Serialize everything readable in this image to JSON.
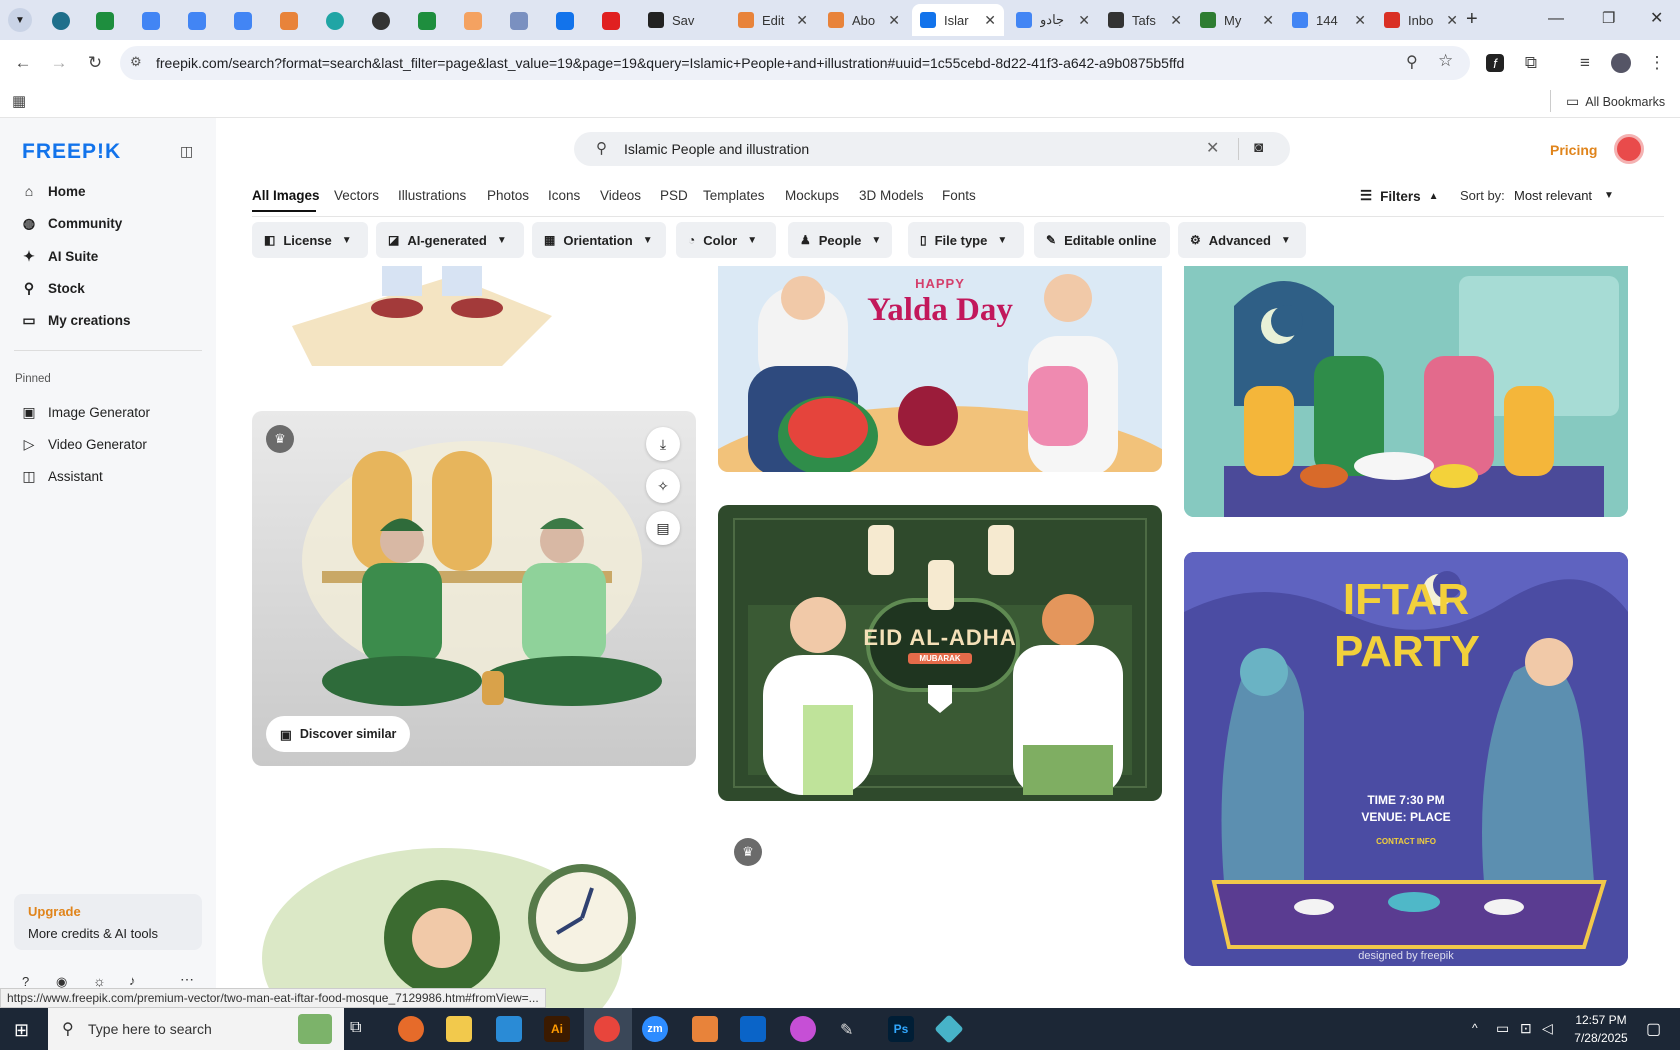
{
  "browser": {
    "tabs": [
      {
        "label": "Sav",
        "color": "#222"
      },
      {
        "label": "Edit",
        "color": "#e8833a"
      },
      {
        "label": "Abo",
        "color": "#e8833a"
      },
      {
        "label": "Islar",
        "color": "#1273eb",
        "active": true
      },
      {
        "label": "جادو",
        "color": "#4285f4"
      },
      {
        "label": "Tafs",
        "color": "#333"
      },
      {
        "label": "My",
        "color": "#2e7d32"
      },
      {
        "label": "144",
        "color": "#4285f4"
      },
      {
        "label": "Inbo",
        "color": "#d93025"
      }
    ],
    "url": "freepik.com/search?format=search&last_filter=page&last_value=19&page=19&query=Islamic+People+and+illustration#uuid=1c55cebd-8d22-41f3-a642-a9b0875b5ffd",
    "bookmarks_label": "All Bookmarks",
    "status_url": "https://www.freepik.com/premium-vector/two-man-eat-iftar-food-mosque_7129986.htm#fromView=..."
  },
  "sidebar": {
    "logo": "FREEP!K",
    "nav": [
      {
        "label": "Home",
        "icon": "home-icon",
        "glyph": "⌂"
      },
      {
        "label": "Community",
        "icon": "globe-icon",
        "glyph": "◍"
      },
      {
        "label": "AI Suite",
        "icon": "sparkle-icon",
        "glyph": "✦"
      },
      {
        "label": "Stock",
        "icon": "search-icon",
        "glyph": "⚲"
      },
      {
        "label": "My creations",
        "icon": "folder-icon",
        "glyph": "▭"
      }
    ],
    "pinned_heading": "Pinned",
    "pinned": [
      {
        "label": "Image Generator",
        "icon": "image-icon",
        "glyph": "▣"
      },
      {
        "label": "Video Generator",
        "icon": "video-icon",
        "glyph": "▷"
      },
      {
        "label": "Assistant",
        "icon": "assistant-icon",
        "glyph": "◫"
      }
    ],
    "upgrade": {
      "title": "Upgrade",
      "subtitle": "More credits & AI tools"
    }
  },
  "search": {
    "query": "Islamic People and illustration"
  },
  "header": {
    "pricing": "Pricing"
  },
  "categories": [
    "All Images",
    "Vectors",
    "Illustrations",
    "Photos",
    "Icons",
    "Videos",
    "PSD",
    "Templates",
    "Mockups",
    "3D Models",
    "Fonts"
  ],
  "filters_label": "Filters",
  "sort": {
    "label": "Sort by:",
    "value": "Most relevant"
  },
  "chips": [
    {
      "label": "License",
      "glyph": "◧"
    },
    {
      "label": "AI-generated",
      "glyph": "◪"
    },
    {
      "label": "Orientation",
      "glyph": "▦"
    },
    {
      "label": "Color",
      "glyph": "◔"
    },
    {
      "label": "People",
      "glyph": "♟"
    },
    {
      "label": "File type",
      "glyph": "▯"
    },
    {
      "label": "Editable online",
      "glyph": "✎"
    },
    {
      "label": "Advanced",
      "glyph": "⚙"
    }
  ],
  "cards": {
    "discover_similar": "Discover similar",
    "yalda": {
      "line1": "HAPPY",
      "line2": "Yalda Day"
    },
    "eid": {
      "title": "EID AL-ADHA",
      "subtitle": "MUBARAK"
    },
    "iftar": {
      "line1": "IFTAR",
      "line2": "PARTY",
      "time": "TIME 7:30 PM",
      "venue": "VENUE: PLACE",
      "contact": "CONTACT INFO",
      "credit": "designed by freepik"
    }
  },
  "taskbar": {
    "search_placeholder": "Type here to search",
    "time": "12:57 PM",
    "date": "7/28/2025"
  }
}
